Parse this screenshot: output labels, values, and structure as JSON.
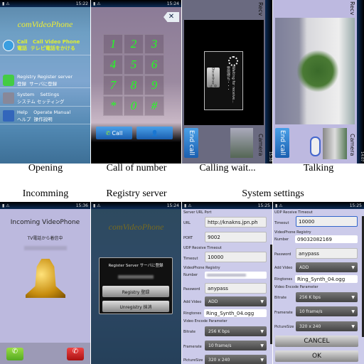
{
  "captions": {
    "opening": "Opening",
    "call_number": "Call of number",
    "calling": "Calling wait...",
    "talking": "Talking",
    "incoming": "Incomming",
    "registry": "Registry server",
    "settings": "System settings"
  },
  "status_times": [
    "15:22",
    "15:24",
    "15:38",
    "14:07",
    "15:36",
    "15:24",
    "15:25",
    "15:25"
  ],
  "opening": {
    "title": "comVideoPhone",
    "items": [
      {
        "icon": "phone-icon",
        "en": "Call",
        "en2": "Call Video Phone",
        "jp": "電話",
        "jp2": "テレビ電話をかける"
      },
      {
        "icon": "registry-icon",
        "en": "Registry",
        "en2": "Register server",
        "jp": "登録",
        "jp2": "サーバに登録"
      },
      {
        "icon": "tools-icon",
        "en": "System",
        "en2": "Settings",
        "jp": "システム",
        "jp2": "セッティング"
      },
      {
        "icon": "help-icon",
        "en": "Help",
        "en2": "Operate Manual",
        "jp": "ヘルプ",
        "jp2": "操作説明"
      }
    ]
  },
  "dialer": {
    "keys": [
      "1",
      "2",
      "3",
      "4",
      "5",
      "6",
      "7",
      "8",
      "9",
      "*",
      "0",
      "#"
    ],
    "call": "Call",
    "close": "✕"
  },
  "calling": {
    "recv": "Recv",
    "camera": "Camera",
    "end_call": "End call",
    "waiting": "Waiting for receive...",
    "waiting_jp": "受信待ち・・・",
    "discontinue": "Discontinue",
    "discontinue_jp": "中止"
  },
  "talking": {
    "recv": "Recv",
    "camera": "Camera",
    "end_call": "End call"
  },
  "incoming": {
    "title": "Incoming VideoPhone",
    "subtitle": "TV電話から着信中"
  },
  "registry": {
    "title": "comVideoPhone",
    "dialog_title": "Register Server  サーバに登録",
    "registry_btn": "Registry 登録",
    "unregistry_btn": "Unregistry 抹消"
  },
  "settings1": {
    "server_section": "Server URL  Port",
    "url_label": "URL",
    "url": "http://knakns.jpn.ph",
    "port_label": "PORT",
    "port": "9002",
    "udp_section": "UDP Receive Timeout",
    "timeout_label": "Timeout",
    "timeout": "10000",
    "reg_section": "VideoPhone Registry",
    "number_label": "Number",
    "password_label": "Password",
    "password": "anypass",
    "addvideo_label": "Add Video",
    "addvideo": "ADD",
    "ring_label": "Ringtones",
    "ring": "Ring_Synth_04.ogg",
    "enc_section": "Video Encode Parameter",
    "bitrate_label": "Bitrate",
    "bitrate": "256 K bps",
    "framerate_label": "Framerate",
    "framerate": "10  frame/s",
    "picsize_label": "PictureSize",
    "picsize": "320 x 240"
  },
  "settings2": {
    "udp_section": "UDP Receive Timeout",
    "timeout_label": "Timeout",
    "timeout": "10000",
    "reg_section": "VideoPhone Registry",
    "number_label": "Number",
    "number": "09032082169",
    "password_label": "Password",
    "password": "anypass",
    "addvideo_label": "Add Video",
    "addvideo": "ADD",
    "ring_label": "Ringtones",
    "ring": "Ring_Synth_04.ogg",
    "enc_section": "Video Encode Parameter",
    "bitrate_label": "Bitrate",
    "bitrate": "256 K bps",
    "framerate_label": "Framerate",
    "framerate": "10  frame/s",
    "picsize_label": "PictureSize",
    "picsize": "320 x 240",
    "cancel": "CANCEL",
    "ok": "OK"
  }
}
